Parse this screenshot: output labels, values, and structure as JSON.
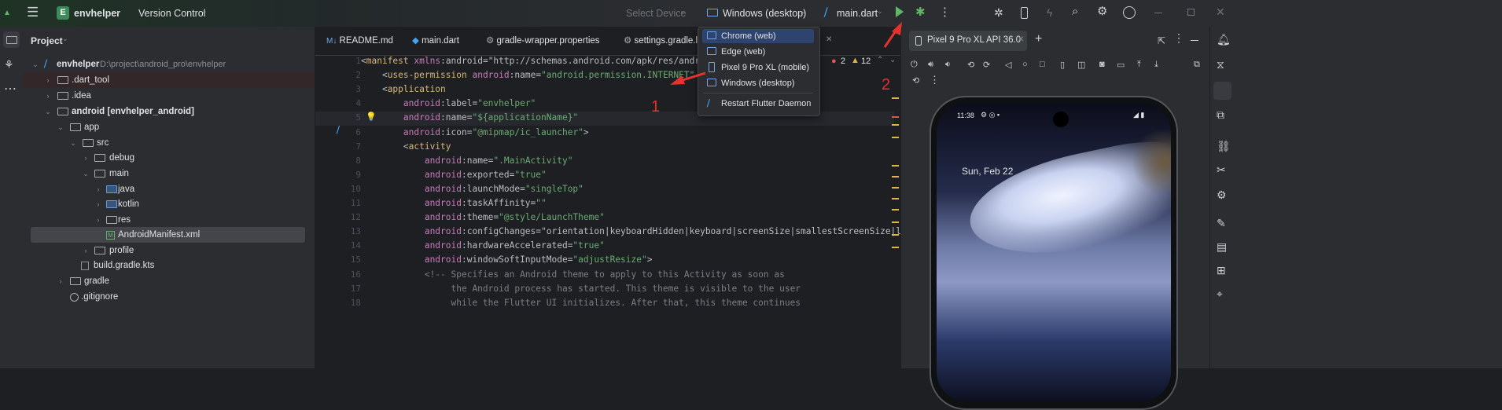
{
  "titlebar": {
    "project_badge": "E",
    "project_name": "envhelper",
    "vcs": "Version Control",
    "select_device": "Select Device",
    "target_device": "Windows (desktop)",
    "run_config": "main.dart"
  },
  "project_panel": {
    "title": "Project",
    "tree": [
      {
        "label": "envhelper",
        "extra": "D:\\project\\android_pro\\envhelper",
        "indent": 0
      },
      {
        "label": ".dart_tool",
        "indent": 1
      },
      {
        "label": ".idea",
        "indent": 1
      },
      {
        "label": "android [envhelper_android]",
        "indent": 1
      },
      {
        "label": "app",
        "indent": 2
      },
      {
        "label": "src",
        "indent": 3
      },
      {
        "label": "debug",
        "indent": 4
      },
      {
        "label": "main",
        "indent": 4
      },
      {
        "label": "java",
        "indent": 5
      },
      {
        "label": "kotlin",
        "indent": 5
      },
      {
        "label": "res",
        "indent": 5
      },
      {
        "label": "AndroidManifest.xml",
        "indent": 5
      },
      {
        "label": "profile",
        "indent": 4
      },
      {
        "label": "build.gradle.kts",
        "indent": 3
      },
      {
        "label": "gradle",
        "indent": 2
      },
      {
        "label": ".gitignore",
        "indent": 2
      }
    ]
  },
  "editor": {
    "tabs": [
      "README.md",
      "main.dart",
      "gradle-wrapper.properties",
      "settings.gradle.l"
    ],
    "errors": "2",
    "warnings": "12",
    "line_numbers": [
      "1",
      "2",
      "3",
      "4",
      "5",
      "6",
      "7",
      "8",
      "9",
      "10",
      "11",
      "12",
      "13",
      "14",
      "15",
      "16",
      "17",
      "18"
    ],
    "lines": [
      "<manifest xmlns:android=\"http://schemas.android.com/apk/res/andro",
      "    <uses-permission android:name=\"android.permission.INTERNET\"",
      "    <application",
      "        android:label=\"envhelper\"",
      "        android:name=\"${applicationName}\"",
      "        android:icon=\"@mipmap/ic_launcher\">",
      "        <activity",
      "            android:name=\".MainActivity\"",
      "            android:exported=\"true\"",
      "            android:launchMode=\"singleTop\"",
      "            android:taskAffinity=\"\"",
      "            android:theme=\"@style/LaunchTheme\"",
      "            android:configChanges=\"orientation|keyboardHidden|keyboard|screenSize|smallestScreenSize|loca",
      "            android:hardwareAccelerated=\"true\"",
      "            android:windowSoftInputMode=\"adjustResize\">",
      "            <!-- Specifies an Android theme to apply to this Activity as soon as",
      "                 the Android process has started. This theme is visible to the user",
      "                 while the Flutter UI initializes. After that, this theme continues"
    ]
  },
  "device_dropdown": {
    "items": [
      "Chrome (web)",
      "Edge (web)",
      "Pixel 9 Pro XL (mobile)",
      "Windows (desktop)"
    ],
    "action": "Restart Flutter Daemon"
  },
  "annotations": {
    "one": "1",
    "two": "2"
  },
  "device_panel": {
    "tab": "Pixel 9 Pro XL API 36.0",
    "phone_time": "11:38",
    "phone_date": "Sun, Feb 22"
  },
  "colors": {
    "accent": "#3574f0",
    "run": "#5fb865",
    "debug": "#5fb865",
    "arrow": "#e5322d"
  }
}
